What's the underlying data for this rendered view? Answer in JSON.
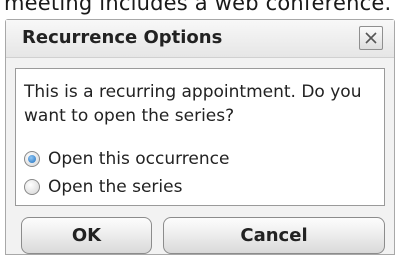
{
  "background": {
    "text": "meeting includes a web conference."
  },
  "dialog": {
    "title": "Recurrence Options",
    "close_icon": "close-icon",
    "message": "This is a recurring appointment. Do you want to open the series?",
    "options": [
      {
        "label": "Open this occurrence",
        "checked": true
      },
      {
        "label": "Open the series",
        "checked": false
      }
    ],
    "buttons": {
      "ok": "OK",
      "cancel": "Cancel"
    },
    "colors": {
      "radio_selected": "#1f6fbd",
      "dialog_background": "#f2f2f2"
    }
  }
}
